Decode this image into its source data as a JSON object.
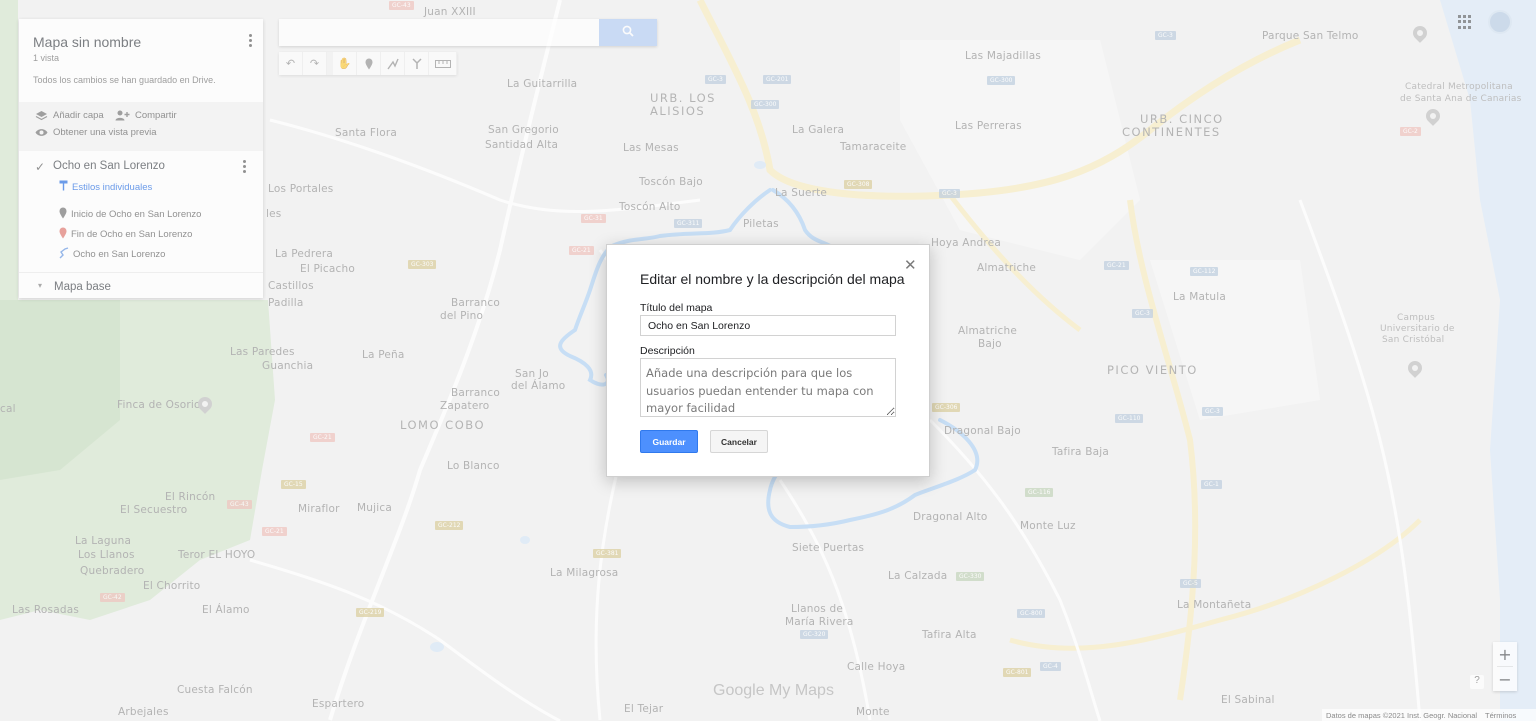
{
  "app": {
    "map_title": "Mapa sin nombre",
    "views": "1 vista",
    "save_status": "Todos los cambios se han guardado en Drive.",
    "add_layer": "Añadir capa",
    "share": "Compartir",
    "preview": "Obtener una vista previa",
    "base_map": "Mapa base",
    "layer": {
      "name": "Ocho en San Lorenzo",
      "styles": "Estilos individuales",
      "features": [
        {
          "label": "Inicio de Ocho en San Lorenzo",
          "icon": "pin-gray-icon"
        },
        {
          "label": "Fin de Ocho en San Lorenzo",
          "icon": "pin-red-icon"
        },
        {
          "label": "Ocho en San Lorenzo",
          "icon": "route-icon"
        }
      ]
    }
  },
  "toolbar": {
    "tools": [
      "undo-icon",
      "redo-icon",
      "hand-icon",
      "marker-icon",
      "draw-line-icon",
      "directions-icon",
      "ruler-icon"
    ]
  },
  "dialog": {
    "title": "Editar el nombre y la descripción del mapa",
    "name_label": "Título del mapa",
    "name_value": "Ocho en San Lorenzo",
    "desc_label": "Descripción",
    "desc_placeholder": "Añade una descripción para que los usuarios puedan entender tu mapa con mayor facilidad",
    "save": "Guardar",
    "cancel": "Cancelar"
  },
  "map": {
    "places": [
      {
        "t": "Juan XXIII"
      },
      {
        "t": "Las Majadillas"
      },
      {
        "t": "Parque San Telmo"
      },
      {
        "t": "La Guitarrilla"
      },
      {
        "t": "URB. LOS"
      },
      {
        "t": "ALISIOS"
      },
      {
        "t": "Catedral Metropolitana"
      },
      {
        "t": "de Santa Ana de Canarias"
      },
      {
        "t": "Santa Flora"
      },
      {
        "t": "San Gregorio"
      },
      {
        "t": "Santidad Alta"
      },
      {
        "t": "La Galera"
      },
      {
        "t": "URB. CINCO"
      },
      {
        "t": "CONTINENTES"
      },
      {
        "t": "Las Perreras"
      },
      {
        "t": "Las Mesas"
      },
      {
        "t": "Tamaraceite"
      },
      {
        "t": "Los Portales"
      },
      {
        "t": "Toscón Bajo"
      },
      {
        "t": "La Suerte"
      },
      {
        "t": "Toscón Alto"
      },
      {
        "t": "Piletas"
      },
      {
        "t": "Hoya Andrea"
      },
      {
        "t": "La Pedrera"
      },
      {
        "t": "El Picacho"
      },
      {
        "t": "Castillos"
      },
      {
        "t": "Almatriche"
      },
      {
        "t": "Padilla"
      },
      {
        "t": "Barranco"
      },
      {
        "t": "del Pino"
      },
      {
        "t": "La Matula"
      },
      {
        "t": "Almatriche"
      },
      {
        "t": "Bajo"
      },
      {
        "t": "Campus"
      },
      {
        "t": "Universitario de"
      },
      {
        "t": "San Cristóbal"
      },
      {
        "t": "Las Paredes"
      },
      {
        "t": "La Peña"
      },
      {
        "t": "Guanchia"
      },
      {
        "t": "San Jo"
      },
      {
        "t": "del Álamo"
      },
      {
        "t": "PICO VIENTO"
      },
      {
        "t": "Finca de Osorio"
      },
      {
        "t": "Barranco"
      },
      {
        "t": "Zapatero"
      },
      {
        "t": "Dragonal Bajo"
      },
      {
        "t": "LOMO COBO"
      },
      {
        "t": "Tafira Baja"
      },
      {
        "t": "Lo Blanco"
      },
      {
        "t": "El Rincón"
      },
      {
        "t": "El Secuestro"
      },
      {
        "t": "Miraflor"
      },
      {
        "t": "Mujica"
      },
      {
        "t": "Dragonal Alto"
      },
      {
        "t": "Monte Luz"
      },
      {
        "t": "La Laguna"
      },
      {
        "t": "Los Llanos"
      },
      {
        "t": "Teror EL HOYO"
      },
      {
        "t": "Quebradero"
      },
      {
        "t": "Siete Puertas"
      },
      {
        "t": "El Chorrito"
      },
      {
        "t": "La Milagrosa"
      },
      {
        "t": "La Calzada"
      },
      {
        "t": "Las Rosadas"
      },
      {
        "t": "El Álamo"
      },
      {
        "t": "La Montañeta"
      },
      {
        "t": "Llanos de"
      },
      {
        "t": "María Rivera"
      },
      {
        "t": "Tafira Alta"
      },
      {
        "t": "Calle Hoya"
      },
      {
        "t": "Cuesta Falcón"
      },
      {
        "t": "Espartero"
      },
      {
        "t": "Arbejales"
      },
      {
        "t": "El Tejar"
      },
      {
        "t": "Monte"
      },
      {
        "t": "El Sabinal"
      },
      {
        "t": "cal"
      },
      {
        "t": "les"
      }
    ],
    "shields": [
      "GC-3",
      "GC-308",
      "GC-300",
      "GC-201",
      "GC-43",
      "GC-21",
      "GC-31",
      "GC-303",
      "GC-110",
      "GC-112",
      "GC-311",
      "GC-1",
      "GC-4",
      "GC-381",
      "GC-320",
      "GC-15",
      "GC-42",
      "GC-212",
      "GC-219",
      "GC-800",
      "GC-801",
      "GC-116",
      "GC-330",
      "GC-306",
      "GC-2",
      "GC-5"
    ]
  },
  "footer": {
    "watermark_google": "Google",
    "watermark_mymaps": " My Maps",
    "attribution": "Datos de mapas ©2021 Inst. Geogr. Nacional",
    "terms": "Términos"
  },
  "colors": {
    "accent": "#4d90fe",
    "route": "#a9cdf0",
    "map_bg": "#ececec",
    "green_area": "#c6dcc0",
    "sea": "#d4e3f4"
  }
}
